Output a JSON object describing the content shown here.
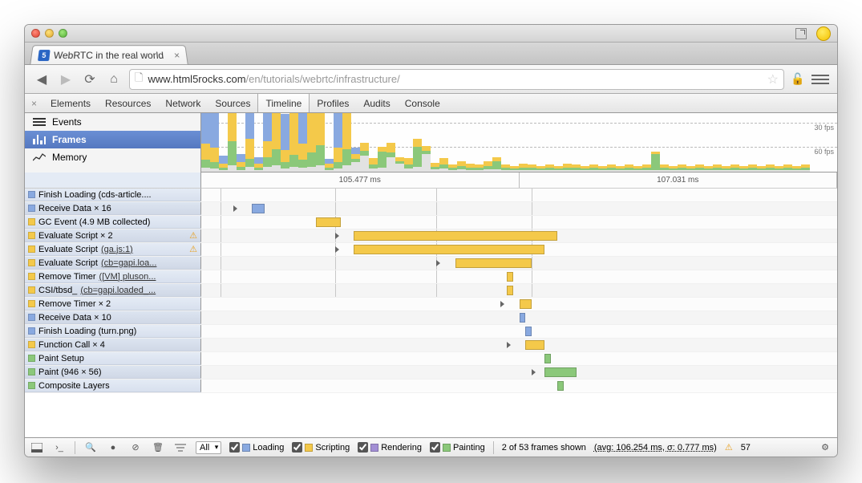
{
  "browser": {
    "tab_title": "WebRTC in the real world",
    "url_host": "www.html5rocks.com",
    "url_path": "/en/tutorials/webrtc/infrastructure/"
  },
  "devtools": {
    "tabs": [
      "Elements",
      "Resources",
      "Network",
      "Sources",
      "Timeline",
      "Profiles",
      "Audits",
      "Console"
    ],
    "active_tab": "Timeline",
    "sidebar": {
      "events": "Events",
      "frames": "Frames",
      "memory": "Memory"
    },
    "fps_labels": {
      "thirty": "30 fps",
      "sixty": "60 fps"
    },
    "ruler": {
      "left_ms": "105.477 ms",
      "right_ms": "107.031 ms"
    },
    "rows": [
      {
        "color": "blue",
        "label": "Finish Loading (cds-article....",
        "warn": false
      },
      {
        "color": "blue",
        "label": "Receive Data × 16",
        "warn": false
      },
      {
        "color": "yellow",
        "label": "GC Event (4.9 MB collected)",
        "warn": false
      },
      {
        "color": "yellow",
        "label": "Evaluate Script × 2",
        "warn": true
      },
      {
        "color": "yellow",
        "label_pre": "Evaluate Script ",
        "link": "(ga.js:1)",
        "warn": true
      },
      {
        "color": "yellow",
        "label_pre": "Evaluate Script ",
        "link": "(cb=gapi.loa...",
        "warn": false
      },
      {
        "color": "yellow",
        "label_pre": "Remove Timer ",
        "link": "([VM] pluson...",
        "warn": false
      },
      {
        "color": "yellow",
        "label_pre": "CSI/tbsd_ ",
        "link": "(cb=gapi.loaded_...",
        "warn": false
      },
      {
        "color": "yellow",
        "label": "Remove Timer × 2",
        "warn": false
      },
      {
        "color": "blue",
        "label": "Receive Data × 10",
        "warn": false
      },
      {
        "color": "blue",
        "label": "Finish Loading (turn.png)",
        "warn": false
      },
      {
        "color": "yellow",
        "label": "Function Call × 4",
        "warn": false
      },
      {
        "color": "green",
        "label": "Paint Setup",
        "warn": false
      },
      {
        "color": "green",
        "label": "Paint (946 × 56)",
        "warn": false
      },
      {
        "color": "green",
        "label": "Composite Layers",
        "warn": false
      }
    ],
    "status": {
      "filter": "All",
      "loading": "Loading",
      "scripting": "Scripting",
      "rendering": "Rendering",
      "painting": "Painting",
      "frames_text": "2 of 53 frames shown",
      "stats": "(avg: 106.254 ms, σ: 0.777 ms)",
      "warn_count": "57"
    }
  }
}
